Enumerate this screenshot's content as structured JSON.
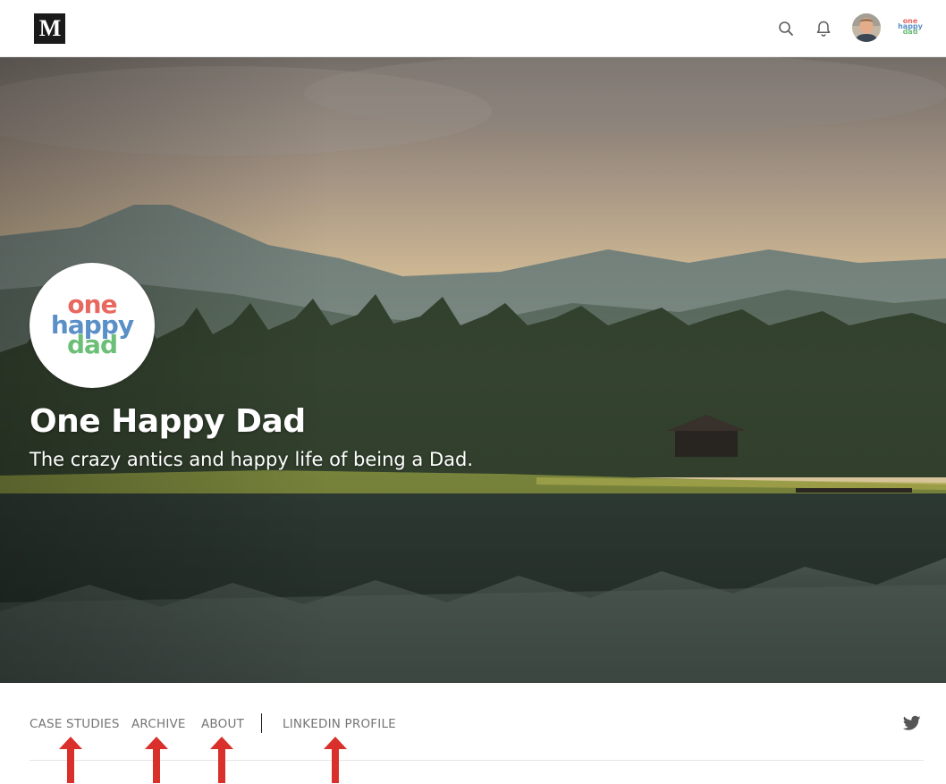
{
  "topbar": {
    "logo_letter": "M",
    "publication_badge": [
      "one",
      "happy",
      "dad"
    ]
  },
  "hero": {
    "logo_words": [
      "one",
      "happy",
      "dad"
    ],
    "title": "One Happy Dad",
    "tagline": "The crazy antics and happy life of being a Dad."
  },
  "nav": {
    "items": [
      "CASE STUDIES",
      "ARCHIVE",
      "ABOUT",
      "LINKEDIN PROFILE"
    ]
  },
  "colors": {
    "logo_one": "#e8685f",
    "logo_happy": "#5a8fc8",
    "logo_dad": "#6bbf76",
    "nav_text": "#757575",
    "annotation_arrow": "#d9302b"
  },
  "icons": [
    "medium-logo-icon",
    "search-icon",
    "bell-icon",
    "avatar",
    "twitter-icon"
  ]
}
